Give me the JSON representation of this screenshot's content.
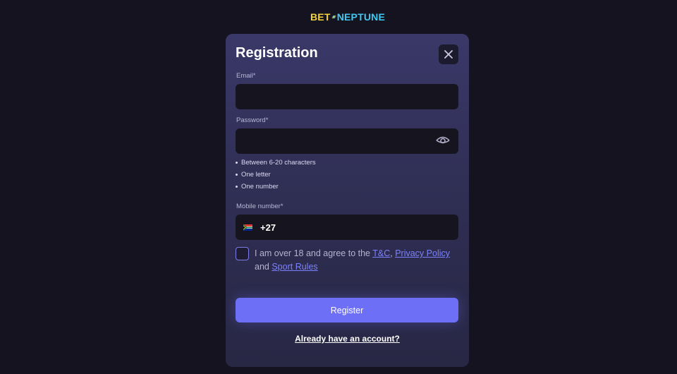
{
  "logo": {
    "bet": "BET",
    "neptune": "NEPTUNE"
  },
  "modal": {
    "title": "Registration"
  },
  "email": {
    "label": "Email*",
    "value": ""
  },
  "password": {
    "label": "Password*",
    "value": "",
    "rules": [
      "Between 6-20 characters",
      "One letter",
      "One number"
    ]
  },
  "mobile": {
    "label": "Mobile number*",
    "prefix": "+27",
    "value": ""
  },
  "agreement": {
    "text_before": "I am over 18 and agree to the ",
    "tc_link": "T&C",
    "comma": ", ",
    "privacy_link": "Privacy Policy",
    "and": " and ",
    "sport_rules_link": "Sport Rules",
    "checked": false
  },
  "register_button": "Register",
  "login_link": "Already have an account?",
  "icons": {
    "close": "close-icon",
    "eye": "eye-icon",
    "flag": "south-africa-flag-icon",
    "logo_planet": "planet-icon"
  },
  "colors": {
    "accent": "#6d70f6",
    "link": "#7b82ff",
    "background": "#14131f",
    "modal": "#302f55"
  }
}
